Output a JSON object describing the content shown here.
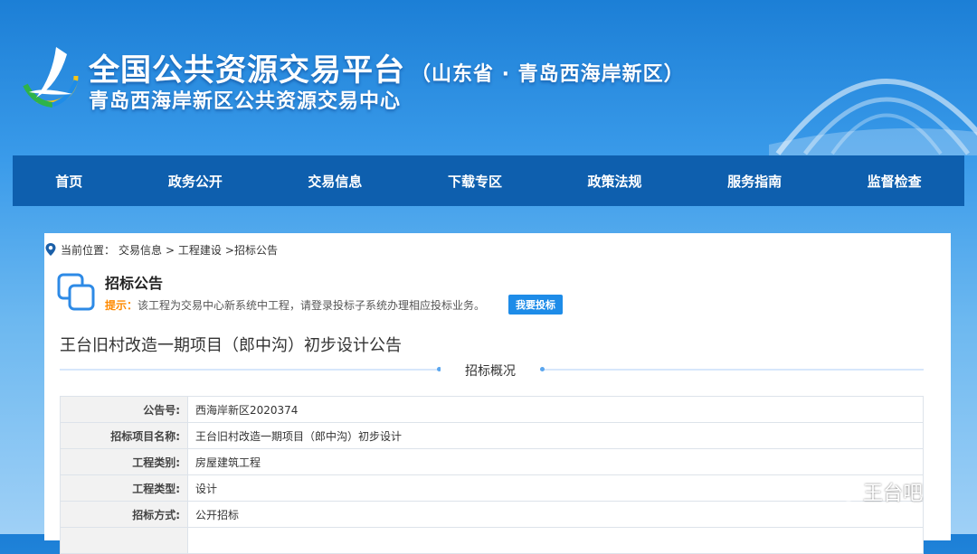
{
  "header": {
    "title": "全国公共资源交易平台",
    "region": "（山东省 · 青岛西海岸新区）",
    "subtitle": "青岛西海岸新区公共资源交易中心"
  },
  "nav": {
    "items": [
      "首页",
      "政务公开",
      "交易信息",
      "下载专区",
      "政策法规",
      "服务指南",
      "监督检查"
    ]
  },
  "breadcrumb": {
    "prefix": "当前位置：",
    "items": [
      "交易信息",
      "> 工程建设",
      ">招标公告"
    ]
  },
  "notice": {
    "title": "招标公告",
    "tip_label": "提示：",
    "tip_text": "该工程为交易中心新系统中工程，请登录投标子系统办理相应投标业务。",
    "bid_button": "我要投标"
  },
  "project": {
    "title": "王台旧村改造一期项目（郎中沟）初步设计公告",
    "section_label": "招标概况",
    "rows": [
      {
        "label": "公告号:",
        "value": "西海岸新区2020374"
      },
      {
        "label": "招标项目名称:",
        "value": "王台旧村改造一期项目（郎中沟）初步设计"
      },
      {
        "label": "工程类别:",
        "value": "房屋建筑工程"
      },
      {
        "label": "工程类型:",
        "value": "设计"
      },
      {
        "label": "招标方式:",
        "value": "公开招标"
      },
      {
        "label": "",
        "value": ""
      }
    ]
  },
  "watermark": {
    "text": "王台吧"
  },
  "colors": {
    "nav_bg": "#0e5fae",
    "button_bg": "#1e8ce8",
    "tip_label": "#ff8a00"
  }
}
